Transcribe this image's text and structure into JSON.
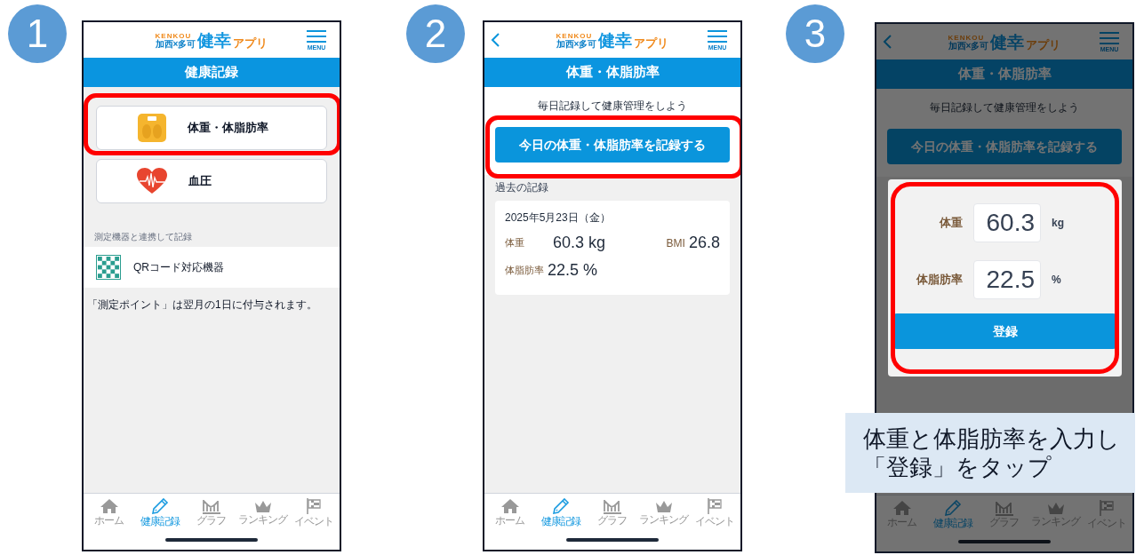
{
  "steps": [
    {
      "number": "1",
      "screen": {
        "kind": "menu",
        "back_button": false,
        "dimmed": false,
        "logo": {
          "caption": "KENKOU",
          "region": "加西×多可",
          "name": "健幸",
          "suffix": "アプリ"
        },
        "menu_label": "MENU",
        "title": "健康記録",
        "record_buttons": [
          {
            "label": "体重・体脂肪率",
            "highlighted": true
          },
          {
            "label": "血圧",
            "highlighted": false
          }
        ],
        "device_heading": "測定機器と連携して記録",
        "devices": [
          {
            "label": "QRコード対応機器"
          }
        ],
        "note": "「測定ポイント」は翌月の1日に付与されます。",
        "nav": [
          {
            "label": "ホーム",
            "selected": false
          },
          {
            "label": "健康記録",
            "selected": true
          },
          {
            "label": "グラフ",
            "selected": false
          },
          {
            "label": "ランキング",
            "selected": false
          },
          {
            "label": "イベント",
            "selected": false
          }
        ]
      }
    },
    {
      "number": "2",
      "screen": {
        "kind": "record",
        "back_button": true,
        "dimmed": false,
        "logo": {
          "caption": "KENKOU",
          "region": "加西×多可",
          "name": "健幸",
          "suffix": "アプリ"
        },
        "menu_label": "MENU",
        "title": "体重・体脂肪率",
        "subtitle": "毎日記録して健康管理をしよう",
        "record_button": {
          "label": "今日の体重・体脂肪率を記録する",
          "highlighted": true
        },
        "past_records": {
          "heading": "過去の記録",
          "entries": [
            {
              "date": "2025年5月23日（金）",
              "weight_label": "体重",
              "weight": "60.3 kg",
              "bmi_label": "BMI",
              "bmi": "26.8",
              "body_fat_label": "体脂肪率",
              "body_fat": "22.5 %"
            }
          ]
        },
        "nav": [
          {
            "label": "ホーム",
            "selected": false
          },
          {
            "label": "健康記録",
            "selected": true
          },
          {
            "label": "グラフ",
            "selected": false
          },
          {
            "label": "ランキング",
            "selected": false
          },
          {
            "label": "イベント",
            "selected": false
          }
        ]
      }
    },
    {
      "number": "3",
      "caption": [
        "体重と体脂肪率を入力し",
        "「登録」をタップ"
      ],
      "screen": {
        "kind": "record",
        "back_button": true,
        "dimmed": true,
        "logo": {
          "caption": "KENKOU",
          "region": "加西×多可",
          "name": "健幸",
          "suffix": "アプリ"
        },
        "menu_label": "MENU",
        "title": "体重・体脂肪率",
        "subtitle": "毎日記録して健康管理をしよう",
        "record_button": {
          "label": "今日の体重・体脂肪率を記録する"
        },
        "dialog": {
          "highlighted": true,
          "fields": [
            {
              "label": "体重",
              "value": "60.3",
              "unit": "kg"
            },
            {
              "label": "体脂肪率",
              "value": "22.5",
              "unit": "%"
            }
          ],
          "submit": "登録"
        },
        "nav": [
          {
            "label": "ホーム",
            "selected": false
          },
          {
            "label": "健康記録",
            "selected": true
          },
          {
            "label": "グラフ",
            "selected": false
          },
          {
            "label": "ランキング",
            "selected": false
          },
          {
            "label": "イベント",
            "selected": false
          }
        ]
      }
    }
  ]
}
